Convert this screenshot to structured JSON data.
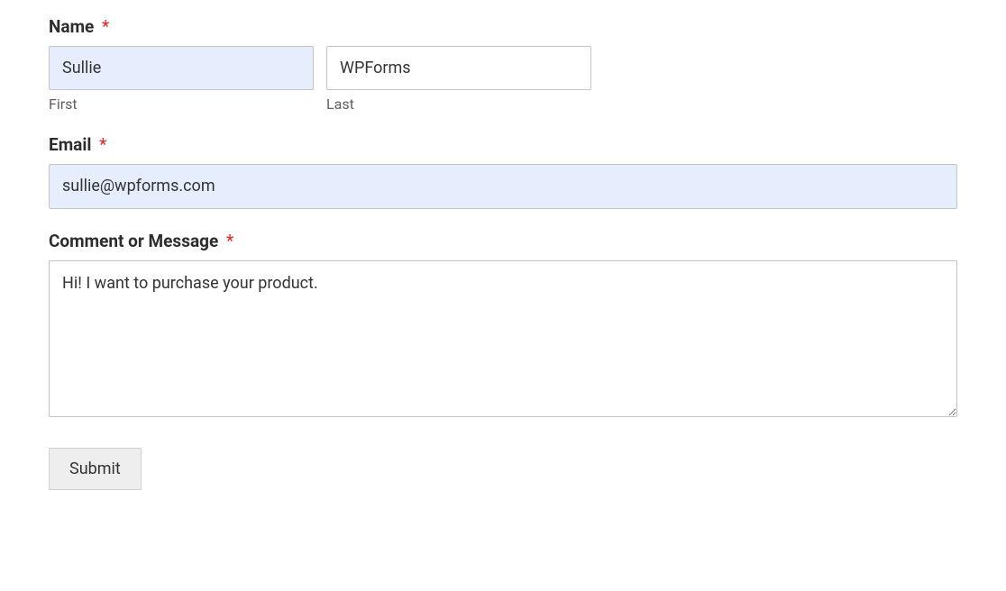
{
  "form": {
    "name": {
      "label": "Name",
      "required": "*",
      "first": {
        "value": "Sullie",
        "sublabel": "First"
      },
      "last": {
        "value": "WPForms",
        "sublabel": "Last"
      }
    },
    "email": {
      "label": "Email",
      "required": "*",
      "value": "sullie@wpforms.com"
    },
    "message": {
      "label": "Comment or Message",
      "required": "*",
      "value": "Hi! I want to purchase your product."
    },
    "submit": {
      "label": "Submit"
    }
  }
}
